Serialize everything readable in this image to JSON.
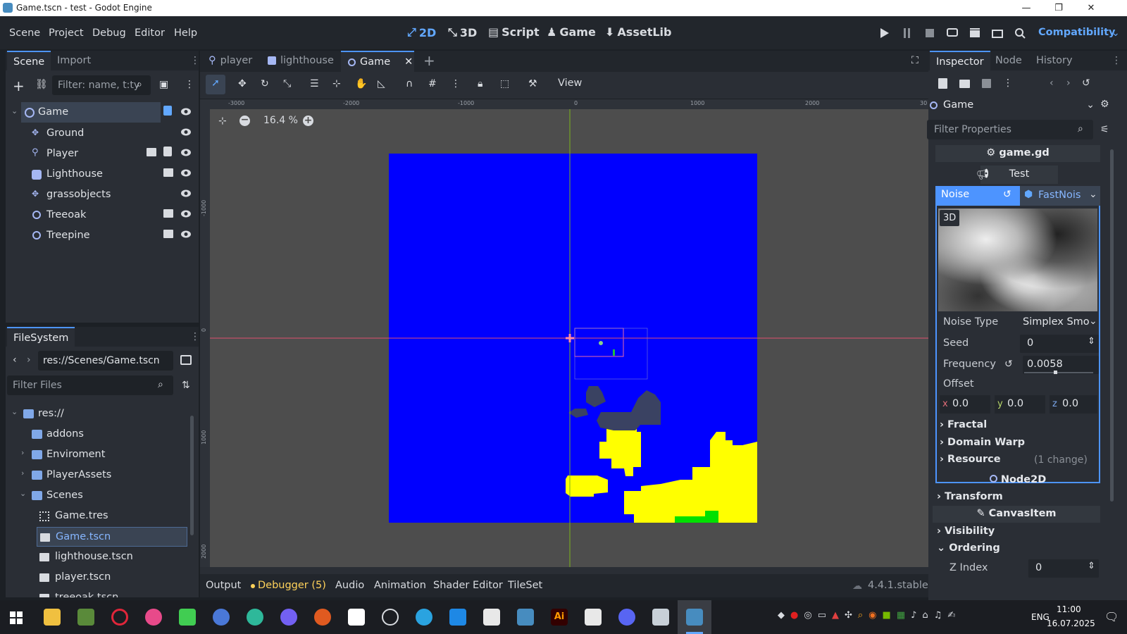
{
  "window": {
    "title": "Game.tscn - test - Godot Engine",
    "minimize": "—",
    "restore": "❐",
    "close": "✕"
  },
  "menu": [
    "Scene",
    "Project",
    "Debug",
    "Editor",
    "Help"
  ],
  "workspaces": [
    {
      "label": "2D",
      "active": true
    },
    {
      "label": "3D",
      "active": false
    },
    {
      "label": "Script",
      "active": false
    },
    {
      "label": "Game",
      "active": false
    },
    {
      "label": "AssetLib",
      "active": false
    }
  ],
  "renderer": "Compatibility",
  "scene_dock": {
    "tabs": [
      "Scene",
      "Import"
    ],
    "filter_placeholder": "Filter: name, t:ty",
    "nodes": [
      {
        "name": "Game",
        "selected": true
      },
      {
        "name": "Ground"
      },
      {
        "name": "Player"
      },
      {
        "name": "Lighthouse"
      },
      {
        "name": "grassobjects"
      },
      {
        "name": "Treeoak"
      },
      {
        "name": "Treepine"
      }
    ]
  },
  "filesystem": {
    "tab": "FileSystem",
    "path": "res://Scenes/Game.tscn",
    "filter_placeholder": "Filter Files",
    "items": [
      {
        "label": "res://",
        "type": "folder",
        "expanded": true
      },
      {
        "label": "addons",
        "type": "folder"
      },
      {
        "label": "Enviroment",
        "type": "folder",
        "collapsed": true
      },
      {
        "label": "PlayerAssets",
        "type": "folder",
        "collapsed": true
      },
      {
        "label": "Scenes",
        "type": "folder",
        "expanded": true
      },
      {
        "label": "Game.tres",
        "type": "resource"
      },
      {
        "label": "Game.tscn",
        "type": "scene",
        "selected": true
      },
      {
        "label": "lighthouse.tscn",
        "type": "scene"
      },
      {
        "label": "player.tscn",
        "type": "scene"
      },
      {
        "label": "treeoak.tscn",
        "type": "scene"
      }
    ]
  },
  "editor_tabs": [
    {
      "label": "player",
      "active": false
    },
    {
      "label": "lighthouse",
      "active": false
    },
    {
      "label": "Game",
      "active": true
    }
  ],
  "toolbar": {
    "view_label": "View"
  },
  "viewport": {
    "zoom": "16.4 %",
    "ruler_h": [
      "-3000",
      "-2000",
      "-1000",
      "0",
      "1000",
      "2000",
      "30"
    ],
    "ruler_v": [
      "-1000",
      "0",
      "1000",
      "2000"
    ]
  },
  "bottom_tabs": [
    "Output",
    "Debugger (5)",
    "Audio",
    "Animation",
    "Shader Editor",
    "TileSet"
  ],
  "version": "4.4.1.stable",
  "inspector": {
    "tabs": [
      "Inspector",
      "Node",
      "History"
    ],
    "object": "Game",
    "filter_placeholder": "Filter Properties",
    "script": "game.gd",
    "test_label": "Test",
    "noise_label": "Noise",
    "noise_resource": "FastNois",
    "preview_badge": "3D",
    "noise_type_label": "Noise Type",
    "noise_type_value": "Simplex Smo",
    "seed_label": "Seed",
    "seed_value": "0",
    "frequency_label": "Frequency",
    "frequency_value": "0.0058",
    "offset_label": "Offset",
    "offset": {
      "x_label": "x",
      "x": "0.0",
      "y_label": "y",
      "y": "0.0",
      "z_label": "z",
      "z": "0.0"
    },
    "fractal": "Fractal",
    "domain_warp": "Domain Warp",
    "resource": "Resource",
    "resource_changes": "(1 change)",
    "node2d": "Node2D",
    "transform": "Transform",
    "canvas_item": "CanvasItem",
    "visibility": "Visibility",
    "ordering": "Ordering",
    "z_index_label": "Z Index",
    "z_index_value": "0"
  },
  "taskbar": {
    "lang": "ENG",
    "time": "11:00",
    "date": "16.07.2025"
  },
  "colors": {
    "accent": "#4d94ff",
    "water": "#0000ff",
    "sand": "#ffff00",
    "grass": "#00e000"
  }
}
